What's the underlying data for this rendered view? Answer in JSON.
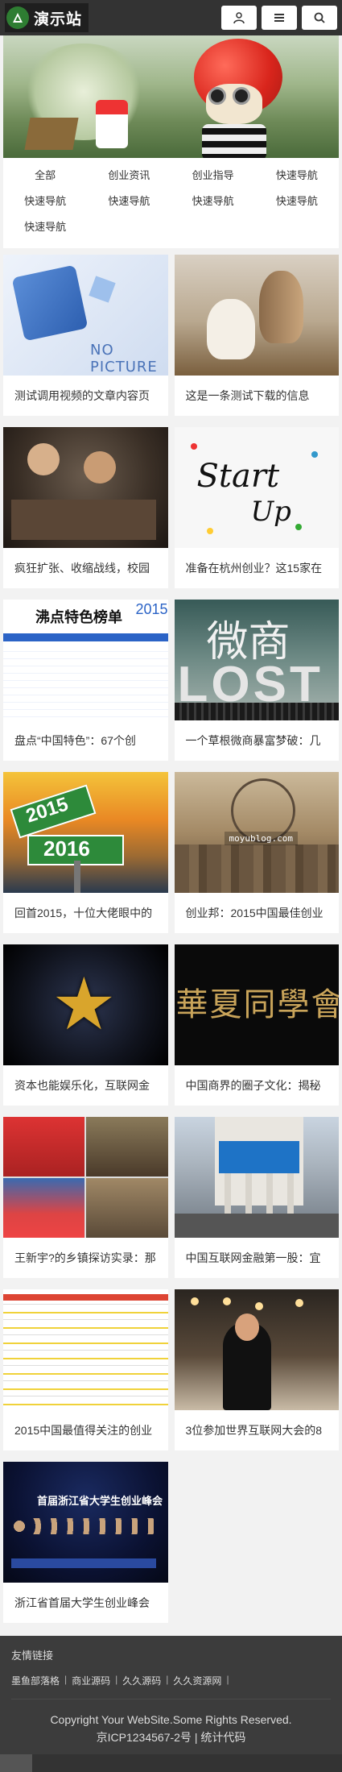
{
  "header": {
    "site_name": "演示站",
    "icons": {
      "logo": "mountain-logo-icon",
      "user": "user-icon",
      "menu": "menu-icon",
      "search": "search-icon"
    }
  },
  "categories": [
    "全部",
    "创业资讯",
    "创业指导",
    "快速导航",
    "快速导航",
    "快速导航",
    "快速导航",
    "快速导航",
    "快速导航"
  ],
  "articles": [
    {
      "title": "测试调用视频的文章内容页",
      "thumb_text": "NO PICTURE"
    },
    {
      "title": "这是一条测试下载的信息"
    },
    {
      "title": "疯狂扩张、收缩战线，校园"
    },
    {
      "title": "准备在杭州创业？这15家在",
      "thumb_text": "Start",
      "thumb_text2": "Up"
    },
    {
      "title": "盘点“中国特色”：67个创",
      "thumb_text": "沸点特色榜单",
      "thumb_text2": "2015"
    },
    {
      "title": "一个草根微商暴富梦破：几",
      "thumb_text": "微商",
      "thumb_text2": "LOST"
    },
    {
      "title": "回首2015，十位大佬眼中的",
      "thumb_text": "2015",
      "thumb_text2": "2016"
    },
    {
      "title": "创业邦：2015中国最佳创业",
      "thumb_text": "moyublog.com"
    },
    {
      "title": "资本也能娱乐化，互联网金"
    },
    {
      "title": "中国商界的圈子文化：揭秘",
      "thumb_text": "華夏同學會"
    },
    {
      "title": "王新宇?的乡镇探访实录：那"
    },
    {
      "title": "中国互联网金融第一股：宜"
    },
    {
      "title": "2015中国最值得关注的创业"
    },
    {
      "title": "3位参加世界互联网大会的8"
    },
    {
      "title": "浙江省首届大学生创业峰会",
      "thumb_text": "首届浙江省大学生创业峰会"
    }
  ],
  "footer": {
    "links_title": "友情链接",
    "links": [
      "墨鱼部落格",
      "商业源码",
      "久久源码",
      "久久资源网"
    ],
    "copyright": "Copyright Your WebSite.Some Rights Reserved.",
    "icp": "京ICP1234567-2号",
    "stats": "统计代码"
  }
}
